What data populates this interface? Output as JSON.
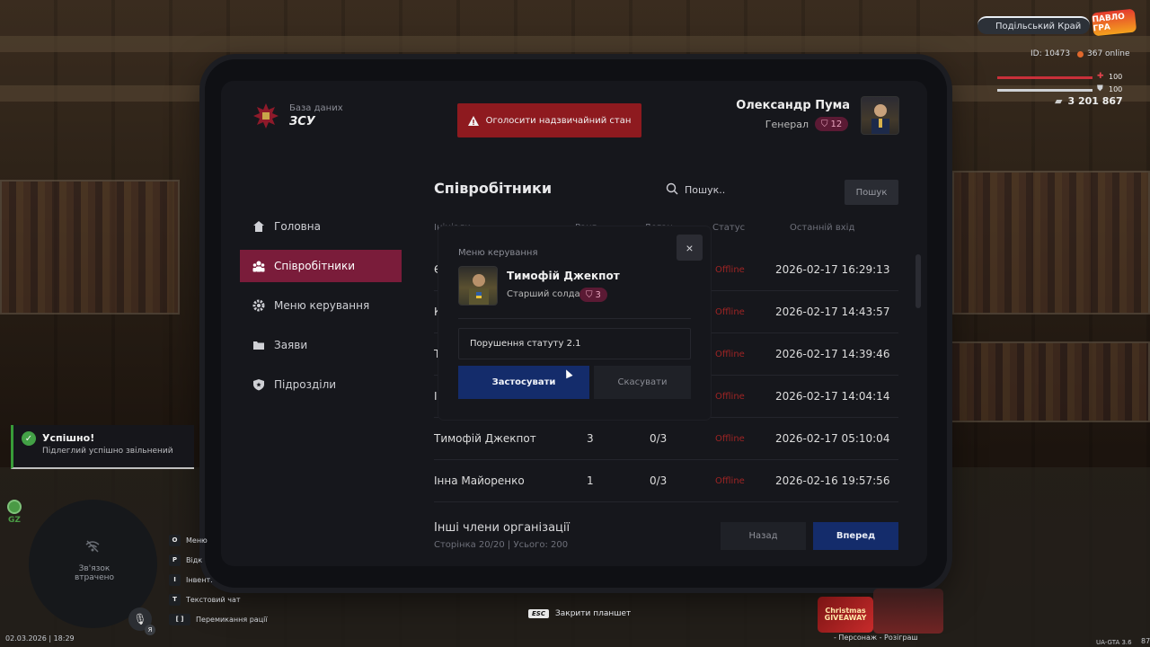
{
  "hud": {
    "server_name": "Подільський Край",
    "game_logo": "ПАВЛО ГРА",
    "player_id": "ID: 10473",
    "online": "367 online",
    "health": "100",
    "armor": "100",
    "money": "3 201 867",
    "toast": {
      "title": "Успішно!",
      "message": "Підлеглий успішно звільнений"
    },
    "zone": "GZ",
    "radar_status": "Зв'язок втрачено",
    "datetime": "02.03.2026 | 18:29",
    "mic_label": "Я",
    "keybinds": [
      {
        "key": "O",
        "label": "Меню"
      },
      {
        "key": "P",
        "label": "Відк"
      },
      {
        "key": "I",
        "label": "Інвент."
      },
      {
        "key": "T",
        "label": "Текстовий чат"
      },
      {
        "key": "[ ]",
        "label": "Перемикання рації"
      }
    ],
    "esc_key": "ESC",
    "esc_hint": "Закрити планшет",
    "promo": "Christmas GIVEAWAY",
    "character_hint": "- Персонаж - Розіграш",
    "version": "UA-GTA 3.6",
    "fps": "87"
  },
  "tablet": {
    "db_label": "База даних",
    "db_name": "ЗСУ",
    "emergency_button": "Оголосити надзвичайний стан",
    "user": {
      "name": "Олександр Пума",
      "rank": "Генерал",
      "rank_level": "12"
    },
    "nav": [
      {
        "label": "Головна",
        "icon": "home-icon",
        "active": false
      },
      {
        "label": "Співробітники",
        "icon": "users-icon",
        "active": true
      },
      {
        "label": "Меню керування",
        "icon": "gear-icon",
        "active": false
      },
      {
        "label": "Заяви",
        "icon": "folder-icon",
        "active": false
      },
      {
        "label": "Підрозділи",
        "icon": "shield-icon",
        "active": false
      }
    ],
    "main": {
      "title": "Співробітники",
      "search_placeholder": "Пошук..",
      "search_button": "Пошук",
      "columns": [
        "Ініціали",
        "Ранг",
        "Доган",
        "Статус",
        "Останній вхід"
      ],
      "rows": [
        {
          "name": "Є",
          "rank": "",
          "warnings": "",
          "status": "Offline",
          "last_login": "2026-02-17 16:29:13"
        },
        {
          "name": "К",
          "rank": "",
          "warnings": "",
          "status": "Offline",
          "last_login": "2026-02-17 14:43:57"
        },
        {
          "name": "Т",
          "rank": "",
          "warnings": "",
          "status": "Offline",
          "last_login": "2026-02-17 14:39:46"
        },
        {
          "name": "І",
          "rank": "",
          "warnings": "",
          "status": "Offline",
          "last_login": "2026-02-17 14:04:14"
        },
        {
          "name": "Тимофій Джекпот",
          "rank": "3",
          "warnings": "0/3",
          "status": "Offline",
          "last_login": "2026-02-17 05:10:04"
        },
        {
          "name": "Інна Майоренко",
          "rank": "1",
          "warnings": "0/3",
          "status": "Offline",
          "last_login": "2026-02-16 19:57:56"
        }
      ],
      "others_title": "Інші члени організації",
      "pagination_info": "Сторінка 20/20 | Усього: 200",
      "back_button": "Назад",
      "forward_button": "Вперед"
    },
    "modal": {
      "title": "Меню керування",
      "close": "×",
      "member_name": "Тимофій Джекпот",
      "member_rank": "Старший солдат",
      "member_rank_level": "3",
      "reason_value": "Порушення статуту 2.1",
      "apply_button": "Застосувати",
      "cancel_button": "Скасувати"
    }
  },
  "colors": {
    "accent_active": "#7a1c3a",
    "primary_button": "#142c6b",
    "emergency": "#8e1a1f",
    "offline_status": "#9e2424",
    "success": "#46a94a"
  }
}
